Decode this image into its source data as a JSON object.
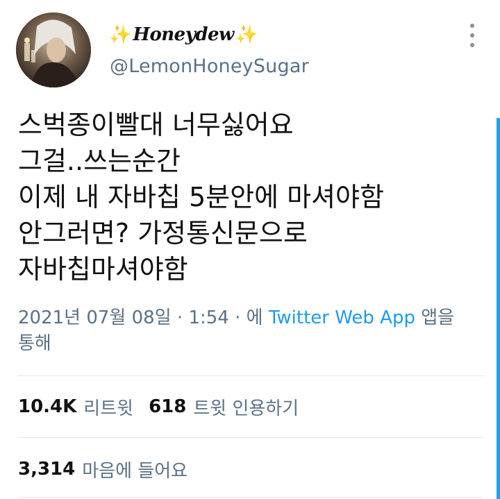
{
  "profile": {
    "sparkle_left": "✨",
    "display_name": "Honeydew",
    "sparkle_right": "✨",
    "username": "@LemonHoneySugar"
  },
  "menu": {
    "icon": "more-vertical-icon"
  },
  "tweet": {
    "lines": [
      "스벅종이빨대 너무싫어요",
      "그걸..쓰는순간",
      "이제 내 자바칩 5분안에 마셔야함",
      "안그러면? 가정통신문으로",
      "자바칩마셔야함"
    ]
  },
  "meta": {
    "date": "2021년 07월 08일",
    "sep1": " · ",
    "time": "1:54",
    "sep2": " · ",
    "prefix": "에 ",
    "app": "Twitter Web App",
    "suffix": " 앱을",
    "suffix2": "통해"
  },
  "stats": {
    "retweets_count": "10.4K",
    "retweets_label": "리트윗",
    "quotes_count": "618",
    "quotes_label": "트윗 인용하기",
    "likes_count": "3,314",
    "likes_label": "마음에 들어요"
  },
  "colors": {
    "secondary_text": "#5b7083",
    "link": "#1d9bf0",
    "divider": "#e1e6ea",
    "sparkle": "#f2b922",
    "scrollbar": "#1da1f2"
  }
}
